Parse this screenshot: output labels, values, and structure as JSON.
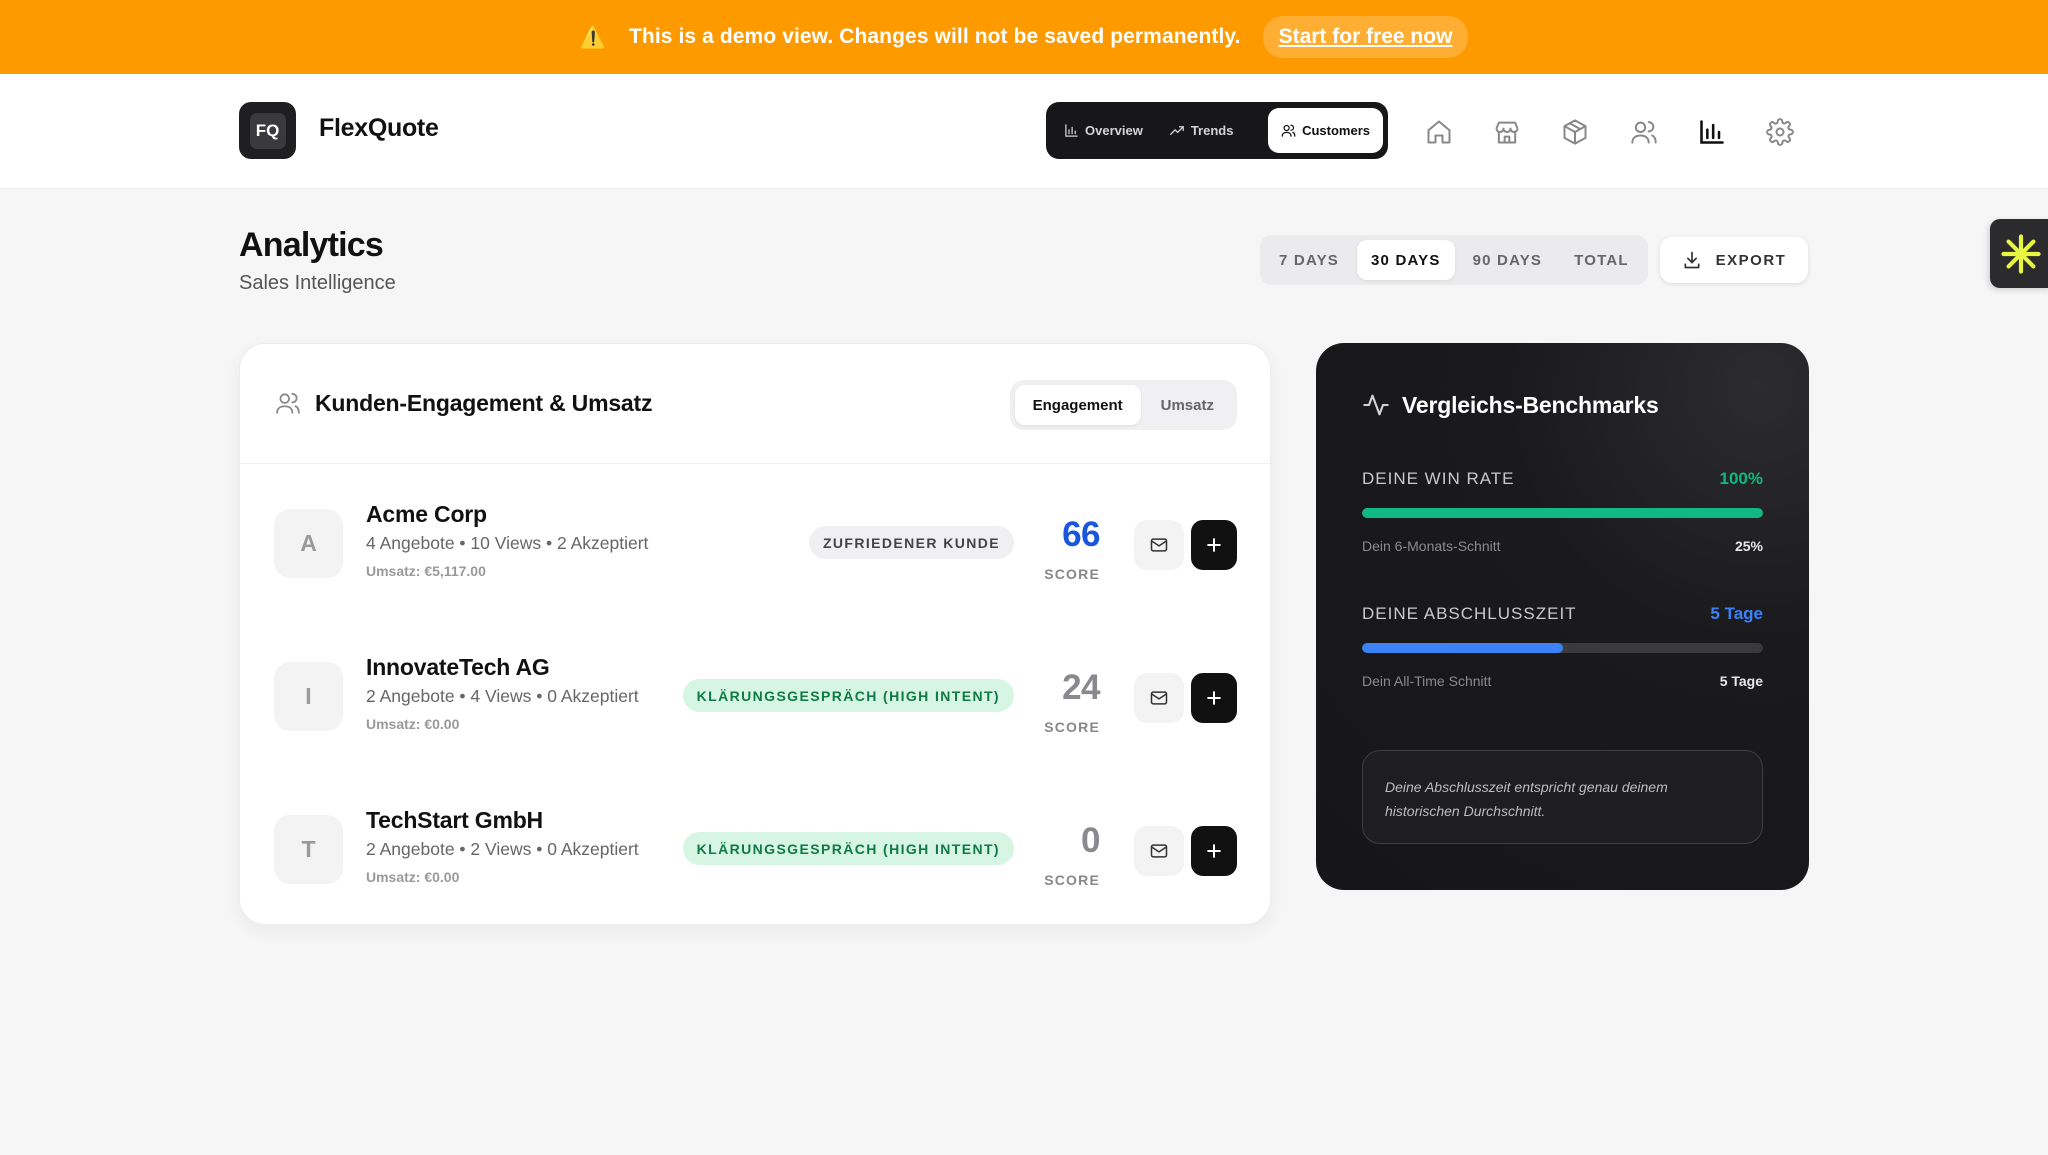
{
  "banner": {
    "warning_glyph": "⚠️",
    "text": "This is a demo view. Changes will not be saved permanently.",
    "cta": "Start for free now"
  },
  "header": {
    "logo_text": "FQ",
    "brand": "FlexQuote",
    "tabs": [
      {
        "label": "Overview",
        "icon": "bar-chart-icon",
        "active": false
      },
      {
        "label": "Trends",
        "icon": "trending-up-icon",
        "active": false
      },
      {
        "label": "Customers",
        "icon": "users-icon",
        "active": true
      }
    ],
    "nav_icons": [
      "home-icon",
      "store-icon",
      "package-icon",
      "users-icon",
      "analytics-icon",
      "settings-icon"
    ]
  },
  "page": {
    "title": "Analytics",
    "subtitle": "Sales Intelligence",
    "ranges": [
      {
        "label": "7 DAYS",
        "active": false
      },
      {
        "label": "30 DAYS",
        "active": true
      },
      {
        "label": "90 DAYS",
        "active": false
      },
      {
        "label": "TOTAL",
        "active": false
      }
    ],
    "export_label": "EXPORT"
  },
  "engagement": {
    "title": "Kunden-Engagement & Umsatz",
    "toggle": [
      {
        "label": "Engagement",
        "active": true
      },
      {
        "label": "Umsatz",
        "active": false
      }
    ],
    "customers": [
      {
        "initial": "A",
        "name": "Acme Corp",
        "meta": "4 Angebote • 10 Views • 2 Akzeptiert",
        "revenue": "Umsatz: €5,117.00",
        "badge": "ZUFRIEDENER KUNDE",
        "badge_type": "neutral",
        "score": "66",
        "score_color": "#1a56db",
        "score_label": "SCORE"
      },
      {
        "initial": "I",
        "name": "InnovateTech AG",
        "meta": "2 Angebote • 4 Views • 0 Akzeptiert",
        "revenue": "Umsatz: €0.00",
        "badge": "KLÄRUNGSGESPRÄCH (HIGH INTENT)",
        "badge_type": "intent",
        "score": "24",
        "score_color": "#8a8a8e",
        "score_label": "SCORE"
      },
      {
        "initial": "T",
        "name": "TechStart GmbH",
        "meta": "2 Angebote • 2 Views • 0 Akzeptiert",
        "revenue": "Umsatz: €0.00",
        "badge": "KLÄRUNGSGESPRÄCH (HIGH INTENT)",
        "badge_type": "intent",
        "score": "0",
        "score_color": "#8a8a8e",
        "score_label": "SCORE"
      }
    ]
  },
  "benchmarks": {
    "title": "Vergleichs-Benchmarks",
    "win_rate": {
      "label": "DEINE WIN RATE",
      "value": "100%",
      "fill": 1.0,
      "color": "#10b981",
      "sub_label": "Dein 6-Monats-Schnitt",
      "sub_value": "25%"
    },
    "close_time": {
      "label": "DEINE ABSCHLUSSZEIT",
      "value": "5 Tage",
      "fill": 0.5,
      "color": "#3b82f6",
      "sub_label": "Dein All-Time Schnitt",
      "sub_value": "5 Tage"
    },
    "note": "Deine Abschlusszeit entspricht genau deinem historischen Durchschnitt."
  },
  "colors": {
    "banner": "#fd9a00",
    "accent_green": "#10b981",
    "accent_blue": "#3b82f6",
    "score_blue": "#1a56db",
    "widget_yellow": "#e8f542"
  }
}
